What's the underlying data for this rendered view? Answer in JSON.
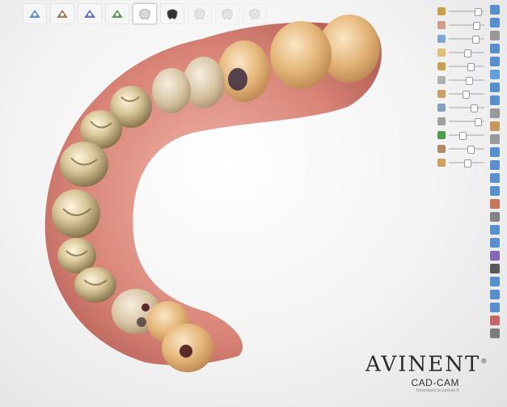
{
  "app": {
    "logo_brand": "AVINENT",
    "logo_registered": "®",
    "logo_sub": "CAD-CAM",
    "logo_small": "Developed by exocad ®"
  },
  "toolbar": {
    "tools": [
      {
        "icon": "scan-edit-icon",
        "state": "normal"
      },
      {
        "icon": "margin-tool-icon",
        "state": "normal"
      },
      {
        "icon": "abutment-tool-icon",
        "state": "normal"
      },
      {
        "icon": "anatomy-tool-icon",
        "state": "normal"
      },
      {
        "icon": "crown-view-icon",
        "state": "active"
      },
      {
        "icon": "dark-tooth-icon",
        "state": "normal"
      },
      {
        "icon": "tooth-outline-icon",
        "state": "disabled"
      },
      {
        "icon": "tooth-outline-2-icon",
        "state": "disabled"
      },
      {
        "icon": "tooth-shape-icon",
        "state": "disabled"
      }
    ]
  },
  "sliders": [
    {
      "icon": "jaw-visibility-icon",
      "color": "#c8a04a",
      "level": 0.85
    },
    {
      "icon": "gingiva-visibility-icon",
      "color": "#d59a8a",
      "level": 0.8
    },
    {
      "icon": "antagonist-visibility-icon",
      "color": "#7fa6cf",
      "level": 0.75
    },
    {
      "icon": "teeth-visibility-icon",
      "color": "#e0c070",
      "level": 0.5
    },
    {
      "icon": "abutment-visibility-icon",
      "color": "#c7a050",
      "level": 0.6
    },
    {
      "icon": "model-visibility-icon",
      "color": "#b0b0b0",
      "level": 0.55
    },
    {
      "icon": "implant-visibility-icon",
      "color": "#c8a060",
      "level": 0.45
    },
    {
      "icon": "scan-visibility-icon",
      "color": "#88a0c0",
      "level": 0.7
    },
    {
      "icon": "bar-visibility-icon",
      "color": "#a0a0a0",
      "level": 0.85
    },
    {
      "icon": "gum-visibility-icon",
      "color": "#4aa04a",
      "level": 0.35
    },
    {
      "icon": "attachment-visibility-icon",
      "color": "#b08a60",
      "level": 0.6
    },
    {
      "icon": "screw-visibility-icon",
      "color": "#d0a060",
      "level": 0.5
    }
  ],
  "iconstrip": [
    {
      "icon": "display-icon",
      "color": "#3d7fc8"
    },
    {
      "icon": "fullscreen-icon",
      "color": "#3d7fc8"
    },
    {
      "icon": "link-icon",
      "color": "#8a8a8a"
    },
    {
      "icon": "camera-icon",
      "color": "#3d7fc8"
    },
    {
      "icon": "view-front-icon",
      "color": "#3d7fc8"
    },
    {
      "icon": "view-back-icon",
      "color": "#4a8fd8"
    },
    {
      "icon": "view-left-icon",
      "color": "#3d7fc8"
    },
    {
      "icon": "view-right-icon",
      "color": "#3d7fc8"
    },
    {
      "icon": "view-top-icon",
      "color": "#8a8a8a"
    },
    {
      "icon": "view-bottom-icon",
      "color": "#c08840"
    },
    {
      "icon": "rotate-icon",
      "color": "#8a8a8a"
    },
    {
      "icon": "zoom-icon",
      "color": "#3d7fc8"
    },
    {
      "icon": "measure-icon",
      "color": "#3d7fc8"
    },
    {
      "icon": "section-icon",
      "color": "#3d7fc8"
    },
    {
      "icon": "color-icon",
      "color": "#3d7fc8"
    },
    {
      "icon": "sphere-icon",
      "color": "#c06040"
    },
    {
      "icon": "sphere-2-icon",
      "color": "#707070"
    },
    {
      "icon": "light-icon",
      "color": "#3d7fc8"
    },
    {
      "icon": "palette-icon",
      "color": "#3d7fc8"
    },
    {
      "icon": "purple-icon",
      "color": "#7050b0"
    },
    {
      "icon": "collapse-icon",
      "color": "#404040"
    },
    {
      "icon": "undo-icon",
      "color": "#3d7fc8"
    },
    {
      "icon": "redo-icon",
      "color": "#3d7fc8"
    },
    {
      "icon": "info-icon",
      "color": "#3d7fc8"
    },
    {
      "icon": "settings-icon",
      "color": "#c05050"
    },
    {
      "icon": "screenshot-icon",
      "color": "#6a6a6a"
    }
  ]
}
